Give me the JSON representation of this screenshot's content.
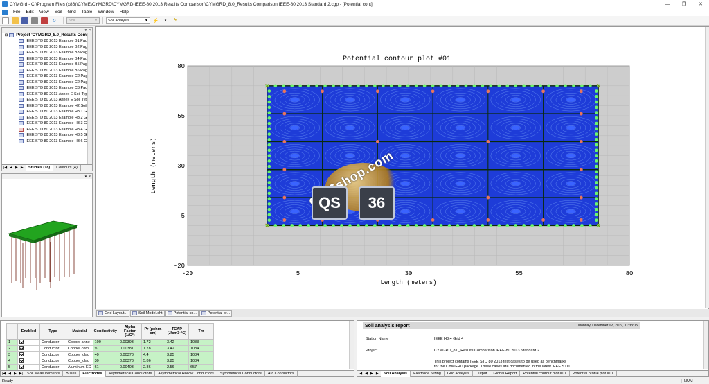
{
  "window": {
    "title": "CYMGrd - C:\\Program Files (x86)\\CYME\\CYMGRD\\CYMGRD-IEEE-80 2013 Results Comparison\\CYMGRD_8.0_Results Comparison IEEE-80 2013 Standard 2.cgp - [Potential cont]",
    "minimize": "—",
    "maximize": "❐",
    "close": "✕"
  },
  "menu": [
    "File",
    "Edit",
    "View",
    "Soil",
    "Grid",
    "Table",
    "Window",
    "Help"
  ],
  "toolbar": {
    "combo1": "Soil",
    "combo2": "Soil Analysis"
  },
  "studies": {
    "root": "Project 'CYMGRD_8.0_Results Com",
    "items": [
      "IEEE STD 80 2013 Example B1 Page",
      "IEEE STD 80 2013 Example B2 Page",
      "IEEE STD 80 2013 Example B3 Page",
      "IEEE STD 80 2013 Example B4 Page",
      "IEEE STD 80 2013 Example B5 Page",
      "IEEE STD 80 2013 Example B6 Page",
      "IEEE STD 80 2013 Example C2 Page",
      "IEEE STD 80 2013 Example C2 Page",
      "IEEE STD 80 2013 Example C3 Page",
      "IEEE STD 80 2013 Annex E Soil Type",
      "IEEE STD 80 2013 Annex E Soil Type",
      "IEEE STD 80 2013 Example H2 Soil A",
      "IEEE STD 80 2013 Example H3.1 Grid",
      "IEEE STD 80 2013 Example H3.2 Grid",
      "IEEE STD 80 2013 Example H3.3 Grid",
      "IEEE STD 80 2013 Example H3.4 Grid",
      "IEEE STD 80 2013 Example H3.5 Grid",
      "IEEE STD 80 2013 Example H3.6 Grid"
    ],
    "tab_studies": "Studies (18)",
    "tab_contours": "Contours (4)"
  },
  "plot": {
    "title": "Potential contour plot #01",
    "xlabel": "Length (meters)",
    "ylabel": "Length (meters)"
  },
  "chart_data": {
    "type": "heatmap",
    "title": "Potential contour plot #01",
    "xlabel": "Length (meters)",
    "ylabel": "Length (meters)",
    "xlim": [
      -20,
      80
    ],
    "ylim": [
      -20,
      80
    ],
    "xticks": [
      -20,
      5,
      30,
      55,
      80
    ],
    "yticks": [
      -20,
      5,
      30,
      55,
      80
    ],
    "grid_extent": {
      "x": [
        -2,
        73
      ],
      "y": [
        0,
        70
      ]
    },
    "grid_color": "#1e3cd8",
    "electrode_color": "#6df56d",
    "rod_color": "#e8755c"
  },
  "window_tabs": [
    "Grid Layout...",
    "Soil Model.cht",
    "Potential co...",
    "Potential pr..."
  ],
  "conductor_table": {
    "headers": [
      "",
      "Enabled",
      "Type",
      "Material",
      "Conductivity",
      "Alpha Factor (1/C°)",
      "Pr (µohm-cm)",
      "TCAP (J/cm3·°C)",
      "Tm"
    ],
    "rows": [
      [
        "1",
        "",
        "Conductor",
        "Copper anne",
        "100",
        "0.00393",
        "1.72",
        "3.42",
        "1083"
      ],
      [
        "2",
        "",
        "Conductor",
        "Copper com",
        "97",
        "0.00381",
        "1.78",
        "3.42",
        "1084"
      ],
      [
        "3",
        "",
        "Conductor",
        "Copper_clad",
        "40",
        "0.00378",
        "4.4",
        "3.85",
        "1084"
      ],
      [
        "4",
        "",
        "Conductor",
        "Copper_clad",
        "30",
        "0.00378",
        "5.86",
        "3.85",
        "1084"
      ],
      [
        "5",
        "",
        "Conductor",
        "Aluminum EC",
        "61",
        "0.00403",
        "2.86",
        "2.56",
        "657"
      ]
    ],
    "tabs": [
      "Soil Measurements",
      "Buses",
      "Electrodes",
      "Asymmetrical Conductors",
      "Asymmetrical Hollow Conductors",
      "Symmetrical Conductors",
      "Arc Conductors"
    ]
  },
  "report": {
    "title": "Soil analysis report",
    "date": "Monday, December 02, 2019, 11:33:05",
    "station_label": "Station Name",
    "station_value": "IEEE H3.4 Grid 4",
    "project_label": "Project",
    "project_value": "CYMGRD_8.0_Results Comparison IEEE-80 2013 Standard 2",
    "description_line1": "This project contains IEEE STD 80 2013 test cases to be used as benchmarks",
    "description_line2": "for the CYMGRD package. These cases are documented in the latest IEEE STD",
    "tabs": [
      "Soil Analysis",
      "Electrode Sizing",
      "Grid Analysis",
      "Output",
      "Global Report",
      "Potential contour plot #01",
      "Potential profile plot #01"
    ]
  },
  "status": {
    "left": "Ready",
    "num": "NUM"
  },
  "watermark": {
    "text": "qs36shop.com",
    "left_box": "QS",
    "right_box": "36"
  }
}
